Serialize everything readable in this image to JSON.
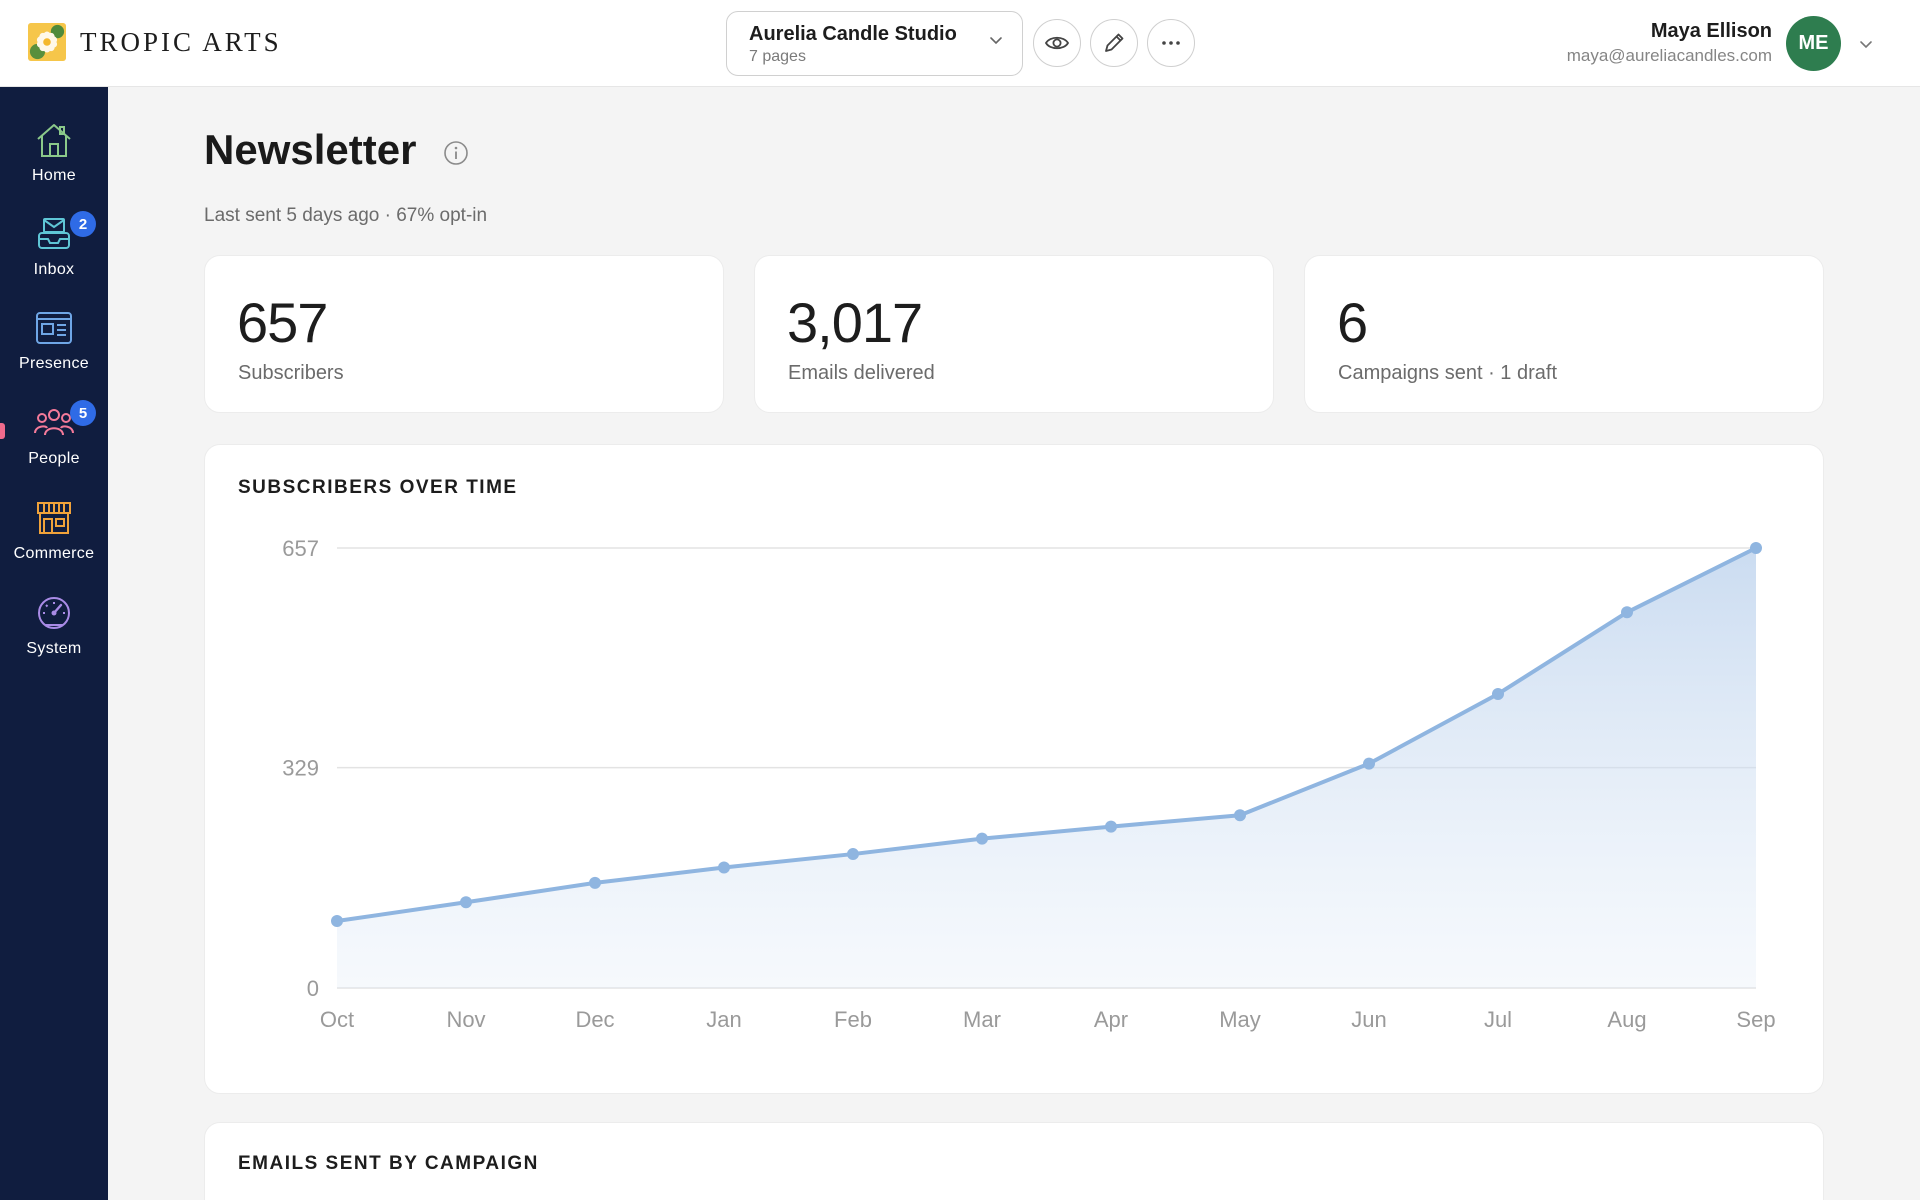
{
  "brand": {
    "name": "TROPIC ARTS"
  },
  "site": {
    "name": "Aurelia Candle Studio",
    "pages": "7 pages"
  },
  "header_actions": [
    "eye-icon",
    "pencil-icon",
    "more-icon"
  ],
  "user": {
    "name": "Maya Ellison",
    "email": "maya@aureliacandles.com",
    "initials": "ME",
    "avatar_color": "#2e7d4f"
  },
  "sidebar": {
    "items": [
      {
        "label": "Home",
        "icon": "home-icon",
        "badge": ""
      },
      {
        "label": "Inbox",
        "icon": "inbox-icon",
        "badge": "2"
      },
      {
        "label": "Presence",
        "icon": "presence-icon",
        "badge": ""
      },
      {
        "label": "People",
        "icon": "people-icon",
        "badge": "5"
      },
      {
        "label": "Commerce",
        "icon": "storefront-icon",
        "badge": ""
      },
      {
        "label": "System",
        "icon": "gauge-icon",
        "badge": ""
      }
    ],
    "active": "People"
  },
  "page": {
    "title": "Newsletter",
    "subtitle": "Last sent 5 days ago · 67% opt-in"
  },
  "stats": [
    {
      "value": "657",
      "label": "Subscribers"
    },
    {
      "value": "3,017",
      "label": "Emails delivered"
    },
    {
      "value": "6",
      "label": "Campaigns sent · 1 draft"
    }
  ],
  "subscribers_panel": {
    "title": "SUBSCRIBERS OVER TIME"
  },
  "campaign_panel": {
    "title": "EMAILS SENT BY CAMPAIGN"
  },
  "colors": {
    "sidebar_bg": "#101d3f",
    "accent": "#2f6be6",
    "line": "#8fb5e0"
  },
  "chart_data": {
    "type": "area",
    "title": "SUBSCRIBERS OVER TIME",
    "xlabel": "",
    "ylabel": "",
    "categories": [
      "Oct",
      "Nov",
      "Dec",
      "Jan",
      "Feb",
      "Mar",
      "Apr",
      "May",
      "Jun",
      "Jul",
      "Aug",
      "Sep"
    ],
    "values": [
      100,
      128,
      157,
      180,
      200,
      223,
      241,
      258,
      335,
      439,
      561,
      657
    ],
    "yticks": [
      "0",
      "329",
      "657"
    ],
    "ylim": [
      0,
      657
    ],
    "grid": true,
    "legend": "none"
  }
}
